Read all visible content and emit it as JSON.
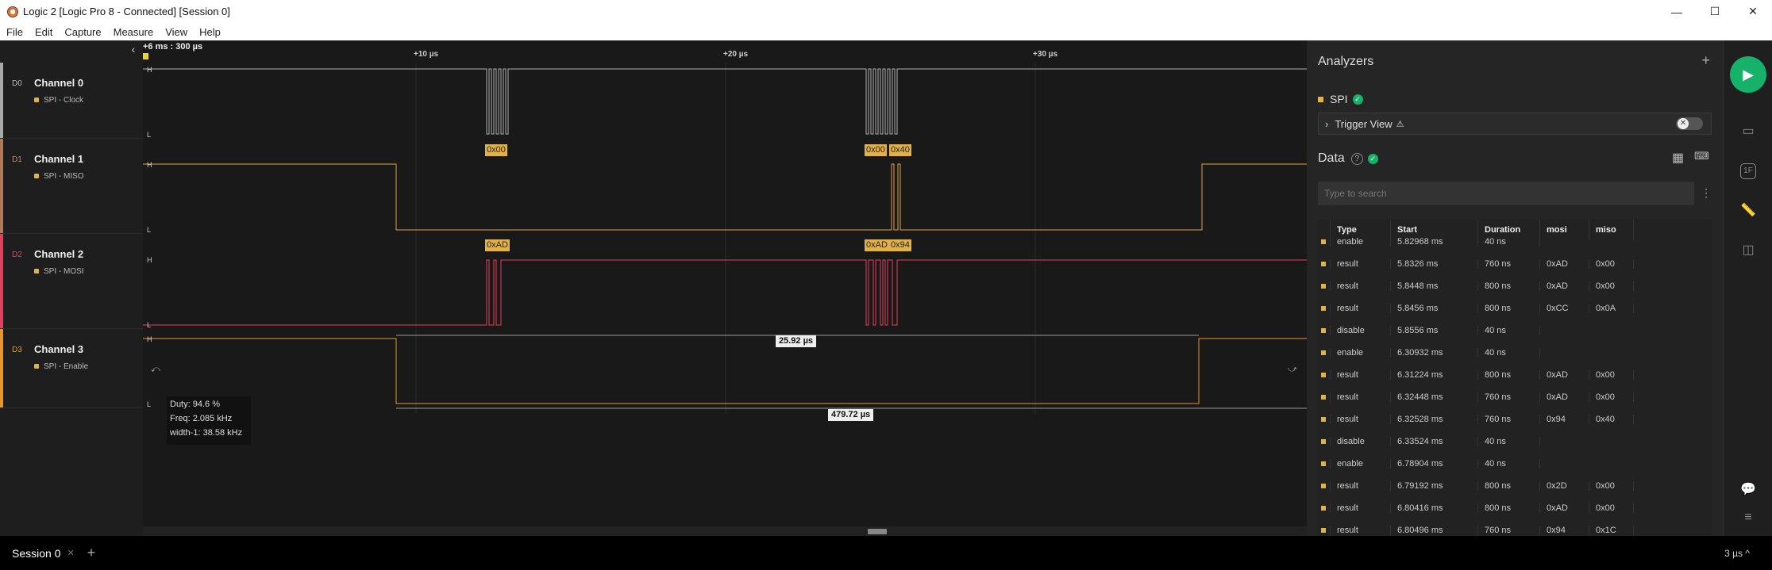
{
  "window": {
    "title": "Logic 2 [Logic Pro 8 - Connected] [Session 0]",
    "minimize": "—",
    "maximize": "☐",
    "close": "✕"
  },
  "menu": [
    "File",
    "Edit",
    "Capture",
    "Measure",
    "View",
    "Help"
  ],
  "timeline": {
    "origin": "+6 ms : 300 µs",
    "ticks": [
      "+10 µs",
      "+20 µs",
      "+30 µs"
    ]
  },
  "channels": [
    {
      "id": "D0",
      "name": "Channel 0",
      "sub": "SPI - Clock",
      "color": "#a9a9a9"
    },
    {
      "id": "D1",
      "name": "Channel 1",
      "sub": "SPI - MISO",
      "color": "#b07a5a"
    },
    {
      "id": "D2",
      "name": "Channel 2",
      "sub": "SPI - MOSI",
      "color": "#e24060"
    },
    {
      "id": "D3",
      "name": "Channel 3",
      "sub": "SPI - Enable",
      "color": "#e8962a"
    }
  ],
  "level_labels": {
    "high": "H",
    "low": "L"
  },
  "decode_labels": {
    "miso": [
      "0x00",
      "0x00",
      "0x40"
    ],
    "mosi": [
      "0xAD",
      "0xAD",
      "0x94"
    ]
  },
  "measurements": {
    "pulse_width": "25.92 µs",
    "period": "479.72 µs",
    "duty": "Duty: 94.6 %",
    "freq": "Freq: 2.085 kHz",
    "width_inv": "width-1: 38.58 kHz"
  },
  "analyzers": {
    "title": "Analyzers",
    "add": "+",
    "items": [
      {
        "name": "SPI"
      }
    ],
    "trigger_view": "Trigger View"
  },
  "data_panel": {
    "title": "Data",
    "search_placeholder": "Type to search",
    "columns": [
      "Type",
      "Start",
      "Duration",
      "mosi",
      "miso"
    ],
    "rows": [
      [
        "enable",
        "5.82968 ms",
        "40 ns",
        "",
        ""
      ],
      [
        "result",
        "5.8326 ms",
        "760 ns",
        "0xAD",
        "0x00"
      ],
      [
        "result",
        "5.8448 ms",
        "800 ns",
        "0xAD",
        "0x00"
      ],
      [
        "result",
        "5.8456 ms",
        "800 ns",
        "0xCC",
        "0x0A"
      ],
      [
        "disable",
        "5.8556 ms",
        "40 ns",
        "",
        ""
      ],
      [
        "enable",
        "6.30932 ms",
        "40 ns",
        "",
        ""
      ],
      [
        "result",
        "6.31224 ms",
        "800 ns",
        "0xAD",
        "0x00"
      ],
      [
        "result",
        "6.32448 ms",
        "760 ns",
        "0xAD",
        "0x00"
      ],
      [
        "result",
        "6.32528 ms",
        "760 ns",
        "0x94",
        "0x40"
      ],
      [
        "disable",
        "6.33524 ms",
        "40 ns",
        "",
        ""
      ],
      [
        "enable",
        "6.78904 ms",
        "40 ns",
        "",
        ""
      ],
      [
        "result",
        "6.79192 ms",
        "800 ns",
        "0x2D",
        "0x00"
      ],
      [
        "result",
        "6.80416 ms",
        "800 ns",
        "0xAD",
        "0x00"
      ],
      [
        "result",
        "6.80496 ms",
        "760 ns",
        "0x94",
        "0x1C"
      ]
    ]
  },
  "footer": {
    "session_tab": "Session 0",
    "zoom": "3 µs ^"
  },
  "colors": {
    "accent_green": "#17b26a",
    "decode_label": "#e2b24a",
    "clock": "#b0b0b0",
    "miso": "#e2a23a",
    "mosi": "#e24060",
    "enable": "#e8962a"
  }
}
